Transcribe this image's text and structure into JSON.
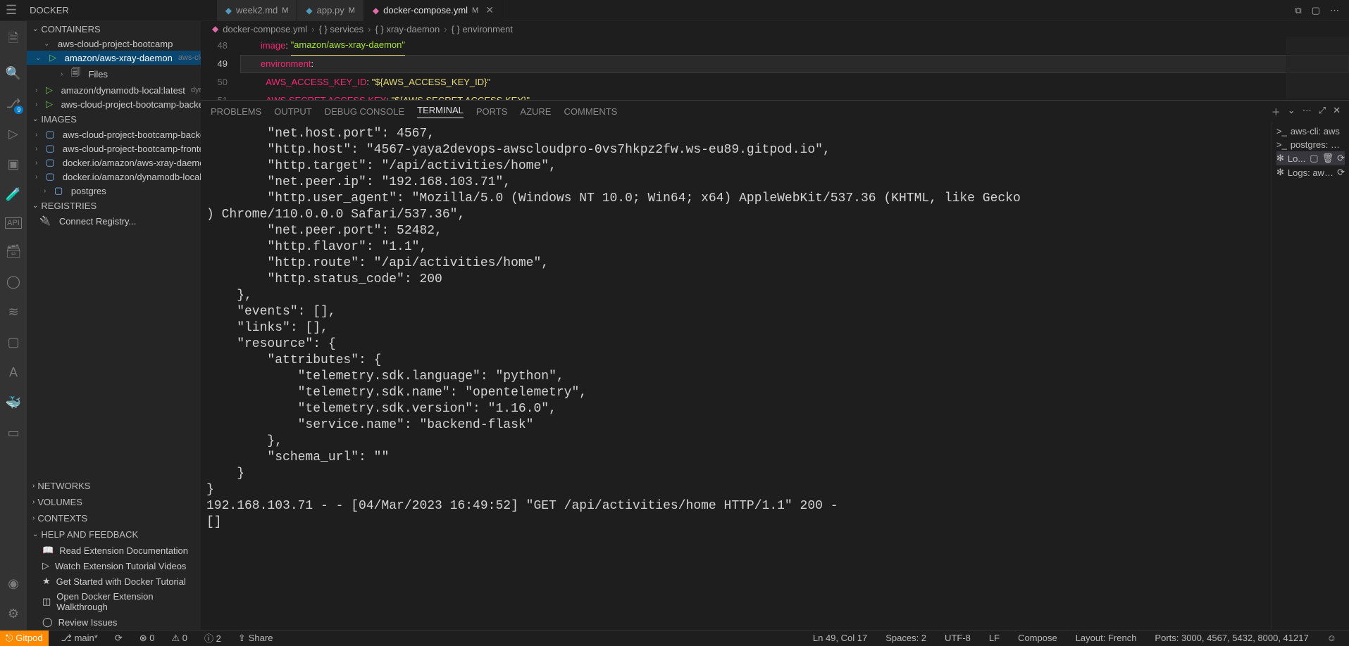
{
  "title": "DOCKER",
  "tabs": [
    {
      "icon": "◆",
      "iconColor": "blue",
      "label": "week2.md",
      "mark": "M",
      "close": false
    },
    {
      "icon": "◆",
      "iconColor": "blue",
      "label": "app.py",
      "mark": "M",
      "close": false
    },
    {
      "icon": "◆",
      "iconColor": "pink",
      "label": "docker-compose.yml",
      "mark": "M",
      "close": true,
      "active": true
    }
  ],
  "topbarRightIcons": [
    "⧉",
    "▢",
    "⋯"
  ],
  "breadcrumb": [
    "docker-compose.yml",
    "{ } services",
    "{ } xray-daemon",
    "{ } environment"
  ],
  "breadcrumbIcon": "◆",
  "activityBadge": "9",
  "sections": {
    "containers": {
      "label": "CONTAINERS"
    },
    "images": {
      "label": "IMAGES"
    },
    "registries": {
      "label": "REGISTRIES"
    },
    "networks": {
      "label": "NETWORKS"
    },
    "volumes": {
      "label": "VOLUMES"
    },
    "contexts": {
      "label": "CONTEXTS"
    },
    "help": {
      "label": "HELP AND FEEDBACK"
    }
  },
  "containers": [
    {
      "indent": 1,
      "chev": "v",
      "label": "aws-cloud-project-bootcamp"
    },
    {
      "indent": 2,
      "chev": "v",
      "play": true,
      "label": "amazon/aws-xray-daemon",
      "sub": "aws-cloud...",
      "selected": true
    },
    {
      "indent": 3,
      "chev": ">",
      "fileIcon": true,
      "label": "Files"
    },
    {
      "indent": 2,
      "chev": ">",
      "play": true,
      "label": "amazon/dynamodb-local:latest",
      "sub": "dyna..."
    },
    {
      "indent": 2,
      "chev": ">",
      "play": true,
      "label": "aws-cloud-project-bootcamp-backen..."
    }
  ],
  "images": [
    {
      "label": "aws-cloud-project-bootcamp-backend..."
    },
    {
      "label": "aws-cloud-project-bootcamp-frontend..."
    },
    {
      "label": "docker.io/amazon/aws-xray-daemon"
    },
    {
      "label": "docker.io/amazon/dynamodb-local"
    },
    {
      "label": "postgres"
    }
  ],
  "registries": {
    "connect": "Connect Registry..."
  },
  "help": [
    "Read Extension Documentation",
    "Watch Extension Tutorial Videos",
    "Get Started with Docker Tutorial",
    "Open Docker Extension Walkthrough",
    "Review Issues"
  ],
  "editor": {
    "lines": [
      {
        "n": "48",
        "indent": "        ",
        "key": "image",
        "sep": ": ",
        "val": "\"amazon/aws-xray-daemon\"",
        "underlineVal": true,
        "cls": "val"
      },
      {
        "n": "49",
        "indent": "        ",
        "key": "environment",
        "sep": ":",
        "active": true
      },
      {
        "n": "50",
        "indent": "          ",
        "key": "AWS_ACCESS_KEY_ID",
        "sep": ": ",
        "str": "\"${AWS_ACCESS_KEY_ID}\""
      },
      {
        "n": "51",
        "indent": "          ",
        "key": "AWS SECRET ACCESS KEY",
        "sep": ": ",
        "str": "\"${AWS SECRET ACCESS KEY}\""
      }
    ]
  },
  "panelTabs": [
    "PROBLEMS",
    "OUTPUT",
    "DEBUG CONSOLE",
    "TERMINAL",
    "PORTS",
    "AZURE",
    "COMMENTS"
  ],
  "panelActive": "TERMINAL",
  "panelRightIcons": [
    "＋",
    "⌄",
    "⋯",
    "⤢",
    "✕"
  ],
  "terminalSide": [
    {
      "icon": ">_",
      "label": "aws-cli: aws"
    },
    {
      "icon": ">_",
      "label": "postgres: bash"
    },
    {
      "icon": "✻",
      "label": "Lo...",
      "active": true,
      "extra": [
        "▢",
        "🗑",
        "⟳"
      ]
    },
    {
      "icon": "✻",
      "label": "Logs: aws-...",
      "extra": [
        "⟳"
      ]
    }
  ],
  "terminal": "        \"net.host.port\": 4567,\n        \"http.host\": \"4567-yaya2devops-awscloudpro-0vs7hkpz2fw.ws-eu89.gitpod.io\",\n        \"http.target\": \"/api/activities/home\",\n        \"net.peer.ip\": \"192.168.103.71\",\n        \"http.user_agent\": \"Mozilla/5.0 (Windows NT 10.0; Win64; x64) AppleWebKit/537.36 (KHTML, like Gecko\n) Chrome/110.0.0.0 Safari/537.36\",\n        \"net.peer.port\": 52482,\n        \"http.flavor\": \"1.1\",\n        \"http.route\": \"/api/activities/home\",\n        \"http.status_code\": 200\n    },\n    \"events\": [],\n    \"links\": [],\n    \"resource\": {\n        \"attributes\": {\n            \"telemetry.sdk.language\": \"python\",\n            \"telemetry.sdk.name\": \"opentelemetry\",\n            \"telemetry.sdk.version\": \"1.16.0\",\n            \"service.name\": \"backend-flask\"\n        },\n        \"schema_url\": \"\"\n    }\n}\n192.168.103.71 - - [04/Mar/2023 16:49:52] \"GET /api/activities/home HTTP/1.1\" 200 -\n[]",
  "statusbar": {
    "gitpod": "Gitpod",
    "branch": "main*",
    "sync": "⟳",
    "errors": "⊗ 0",
    "warnings": "⚠ 0",
    "info": "ⓘ 2",
    "share": "Share",
    "ln": "Ln 49, Col 17",
    "spaces": "Spaces: 2",
    "enc": "UTF-8",
    "eol": "LF",
    "lang": "Compose",
    "layout": "Layout: French",
    "ports": "Ports: 3000, 4567, 5432, 8000, 41217",
    "feedback": "☺"
  }
}
